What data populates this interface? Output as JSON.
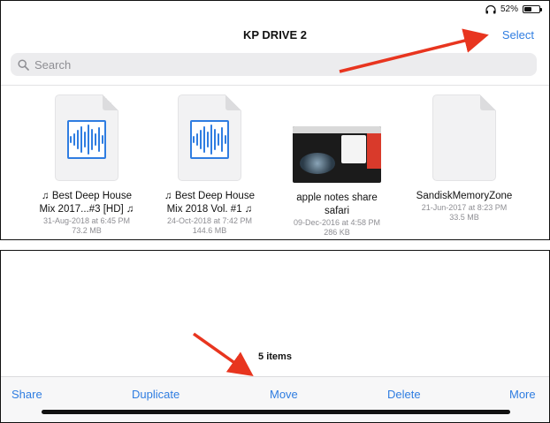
{
  "status_bar": {
    "battery_percent": "52%",
    "battery_level": 0.52,
    "icons": [
      "headphones-icon",
      "battery-icon"
    ]
  },
  "header": {
    "title": "KP DRIVE 2",
    "select_label": "Select"
  },
  "search": {
    "placeholder": "Search",
    "icon": "search-icon"
  },
  "files": [
    {
      "icon": "audio-file-icon",
      "name_line1": "♫ Best Deep House",
      "name_line2": "Mix 2017...#3 [HD] ♫",
      "date": "31-Aug-2018 at 6:45 PM",
      "size": "73.2 MB"
    },
    {
      "icon": "audio-file-icon",
      "name_line1": "♫ Best Deep House",
      "name_line2": "Mix 2018 Vol. #1 ♫",
      "date": "24-Oct-2018 at 7:42 PM",
      "size": "144.6 MB"
    },
    {
      "icon": "image-thumbnail",
      "name_line1": "apple notes share",
      "name_line2": "safari",
      "date": "09-Dec-2016 at 4:58 PM",
      "size": "286 KB"
    },
    {
      "icon": "generic-file-icon",
      "name_line1": "SandiskMemoryZone",
      "name_line2": "",
      "date": "21-Jun-2017 at 8:23 PM",
      "size": "33.5 MB"
    }
  ],
  "footer": {
    "item_count": "5 items"
  },
  "toolbar": {
    "share_label": "Share",
    "duplicate_label": "Duplicate",
    "move_label": "Move",
    "delete_label": "Delete",
    "more_label": "More"
  },
  "colors": {
    "accent": "#2f7de1",
    "annotation_arrow": "#e8351f"
  }
}
